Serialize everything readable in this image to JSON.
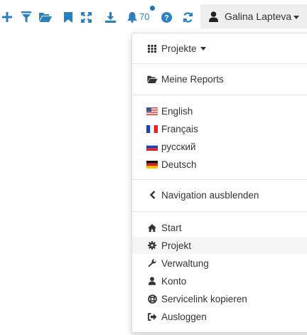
{
  "toolbar": {
    "icons": [
      "plus-icon",
      "filter-icon",
      "folder-open-icon",
      "bookmark-icon",
      "fullscreen-icon",
      "download-icon",
      "bell-icon",
      "help-icon",
      "refresh-icon"
    ],
    "notification_count": "70",
    "accent_color": "#2a7fbf"
  },
  "user": {
    "name": "Galina Lapteva"
  },
  "menu": {
    "projects_label": "Projekte",
    "reports_label": "Meine Reports",
    "languages": [
      {
        "label": "English",
        "flag": "us"
      },
      {
        "label": "Français",
        "flag": "fr"
      },
      {
        "label": "русский",
        "flag": "ru"
      },
      {
        "label": "Deutsch",
        "flag": "de"
      }
    ],
    "hide_nav_label": "Navigation ausblenden",
    "items": [
      {
        "label": "Start",
        "icon": "home-icon"
      },
      {
        "label": "Projekt",
        "icon": "gear-icon"
      },
      {
        "label": "Verwaltung",
        "icon": "wrench-icon"
      },
      {
        "label": "Konto",
        "icon": "user-icon"
      },
      {
        "label": "Servicelink kopieren",
        "icon": "lifebuoy-icon"
      },
      {
        "label": "Ausloggen",
        "icon": "sign-out-icon"
      }
    ]
  }
}
